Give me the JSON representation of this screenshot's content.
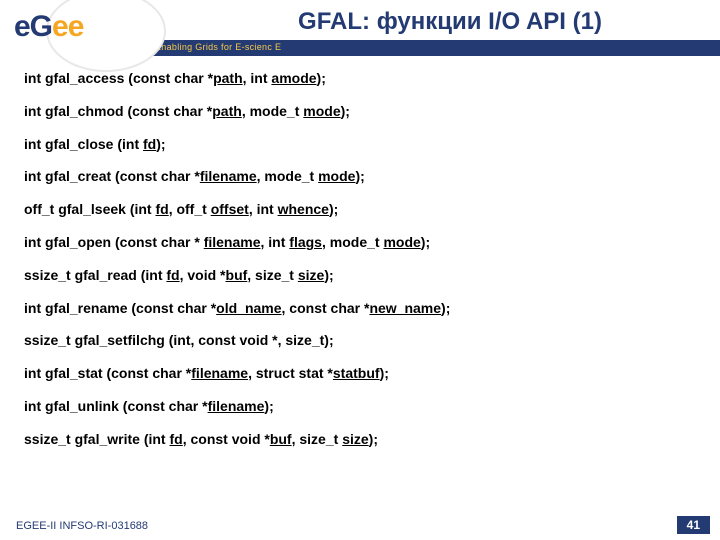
{
  "header": {
    "title": "GFAL: функции I/O API (1)",
    "tagline": "Enabling Grids for E-scienc E",
    "logo_eg": "eG",
    "logo_ee": "ee"
  },
  "lines": [
    {
      "pre": "int gfal_access (const char *",
      "u1": "path",
      "mid1": ", int ",
      "u2": "amode",
      "post": ");"
    },
    {
      "pre": "int gfal_chmod (const char *",
      "u1": "path",
      "mid1": ", mode_t ",
      "u2": "mode",
      "post": ");"
    },
    {
      "pre": "int gfal_close (int ",
      "u1": "fd",
      "post": ");"
    },
    {
      "pre": "int gfal_creat (const char *",
      "u1": "filename",
      "mid1": ", mode_t ",
      "u2": "mode",
      "post": ");"
    },
    {
      "pre": "off_t gfal_lseek (int ",
      "u1": "fd",
      "mid1": ", off_t ",
      "u2": "offset",
      "mid2": ", int ",
      "u3": "whence",
      "post": ");"
    },
    {
      "pre": "int gfal_open (const char * ",
      "u1": "filename",
      "mid1": ", int ",
      "u2": "flags",
      "mid2": ", mode_t ",
      "u3": "mode",
      "post": ");"
    },
    {
      "pre": "ssize_t gfal_read (int ",
      "u1": "fd",
      "mid1": ", void *",
      "u2": "buf",
      "mid2": ", size_t ",
      "u3": "size",
      "post": ");"
    },
    {
      "pre": "int gfal_rename (const char *",
      "u1": "old_name",
      "mid1": ", const char *",
      "u2": "new_name",
      "post": ");"
    },
    {
      "pre": "ssize_t gfal_setfilchg (int, const void *, size_t);",
      "plain": true
    },
    {
      "pre": "int gfal_stat (const char *",
      "u1": "filename",
      "mid1": ", struct stat *",
      "u2": "statbuf",
      "post": ");"
    },
    {
      "pre": "int gfal_unlink (const char *",
      "u1": "filename",
      "post": ");"
    },
    {
      "pre": "ssize_t gfal_write (int ",
      "u1": "fd",
      "mid1": ", const void *",
      "u2": "buf",
      "mid2": ", size_t ",
      "u3": "size",
      "post": ");"
    }
  ],
  "footer": {
    "left": "EGEE-II INFSO-RI-031688",
    "page": "41"
  }
}
